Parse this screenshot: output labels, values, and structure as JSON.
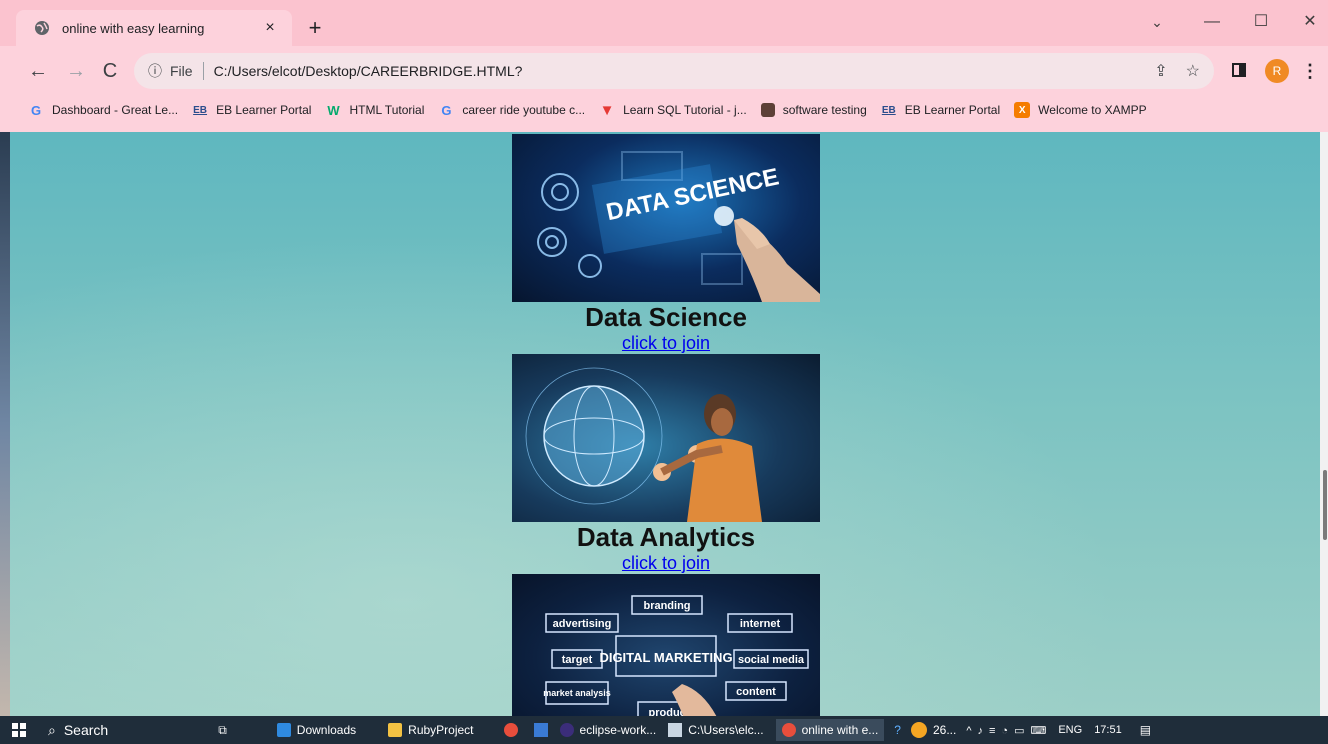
{
  "browser": {
    "tab_title": "online with easy learning",
    "tab_close": "×",
    "new_tab": "+",
    "url_scheme": "File",
    "url": "C:/Users/elcot/Desktop/CAREERBRIDGE.HTML?",
    "avatar_letter": "R",
    "win_minimize": "—",
    "win_maximize": "☐",
    "win_close": "✕",
    "tab_search": "⌄",
    "bookmarks": [
      {
        "label": "Dashboard - Great Le...",
        "icon": "google-icon",
        "color": "#4285f4"
      },
      {
        "label": "EB Learner Portal",
        "icon": "eb-icon",
        "color": "#2b4d8c"
      },
      {
        "label": "HTML Tutorial",
        "icon": "w3schools-icon",
        "color": "#04aa6d"
      },
      {
        "label": "career ride youtube c...",
        "icon": "google-icon",
        "color": "#4285f4"
      },
      {
        "label": "Learn SQL Tutorial - j...",
        "icon": "javatpoint-icon",
        "color": "#e53935"
      },
      {
        "label": "software testing",
        "icon": "cube-icon",
        "color": "#5d4037"
      },
      {
        "label": "EB Learner Portal",
        "icon": "eb-icon",
        "color": "#2b4d8c"
      },
      {
        "label": "Welcome to XAMPP",
        "icon": "xampp-icon",
        "color": "#f57c00"
      }
    ]
  },
  "page": {
    "courses": [
      {
        "title": "Data Science",
        "link": "click to join",
        "image_text": "DATA SCIENCE"
      },
      {
        "title": "Data Analytics",
        "link": "click to join"
      },
      {
        "image_text": "DIGITAL MARKETING",
        "keywords": [
          "branding",
          "advertising",
          "internet",
          "target",
          "social media",
          "market analysis",
          "content",
          "product"
        ]
      }
    ]
  },
  "taskbar": {
    "search": "Search",
    "items": [
      "Downloads",
      "RubyProject",
      "eclipse-work...",
      "C:\\Users\\elc...",
      "online with e..."
    ],
    "weather": "26...",
    "language": "ENG",
    "time": "17:51"
  },
  "colors": {
    "chrome_bg": "#fdd2dc",
    "link": "#0000ee",
    "taskbar": "#1f2d3a"
  }
}
